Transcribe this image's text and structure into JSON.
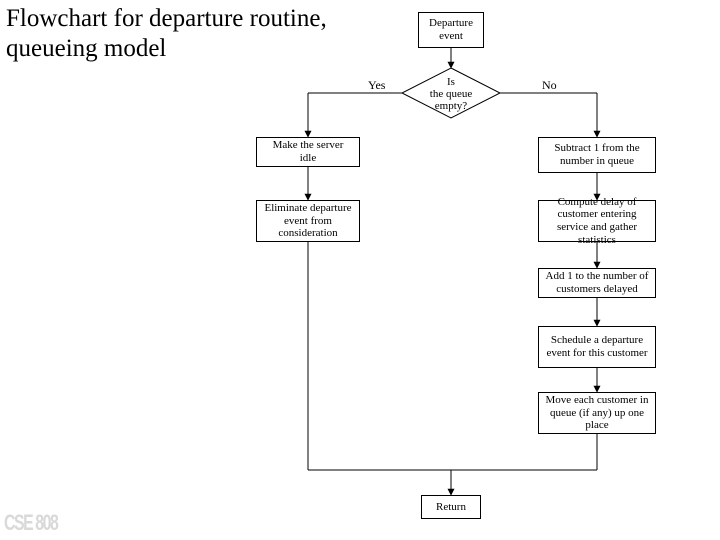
{
  "title": "Flowchart for departure routine, queueing model",
  "nodes": {
    "start": "Departure event",
    "decision_q1": "Is",
    "decision_q2": "the queue",
    "decision_q3": "empty?",
    "yes_idle": "Make the server idle",
    "yes_elim": "Eliminate departure event from consideration",
    "no_sub1": "Subtract 1 from the number in queue",
    "no_delay": "Compute delay of customer entering service and gather statistics",
    "no_add1": "Add 1 to the number of customers delayed",
    "no_sched": "Schedule a departure event for this customer",
    "no_move": "Move each customer in queue (if any) up one place",
    "return": "Return"
  },
  "edges": {
    "yes": "Yes",
    "no": "No"
  },
  "footer": "CSE 808"
}
